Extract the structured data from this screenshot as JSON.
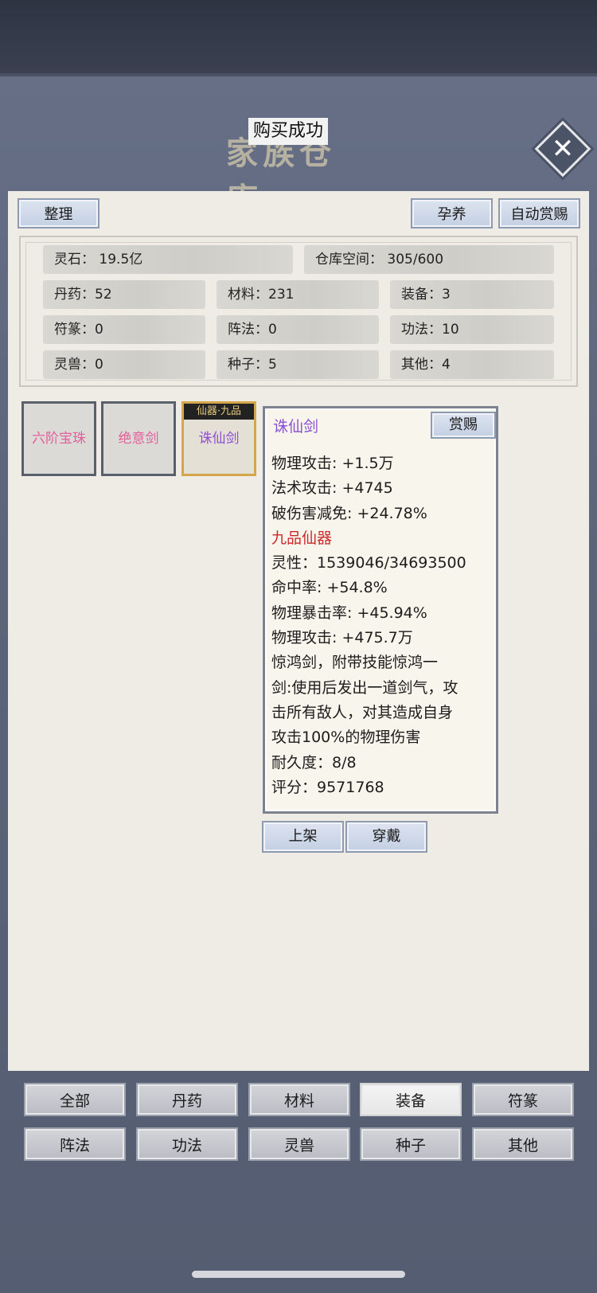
{
  "header": {
    "title": "家族仓库",
    "toast": "购买成功",
    "close_icon": "close-icon"
  },
  "toolbar": {
    "sort_label": "整理",
    "nurture_label": "孕养",
    "auto_reward_label": "自动赏赐"
  },
  "stats": {
    "spirit_stone": "灵石：  19.5亿",
    "capacity": "仓库空间：    305/600",
    "pills": "丹药：52",
    "materials": "材料：231",
    "equipment": "装备：3",
    "talismans": "符篆：0",
    "formations": "阵法：0",
    "techniques": "功法：10",
    "beasts": "灵兽：0",
    "seeds": "种子：5",
    "others": "其他：4"
  },
  "items": [
    {
      "name": "六阶宝珠",
      "color": "#e0609a"
    },
    {
      "name": "绝意剑",
      "color": "#e0609a"
    },
    {
      "name": "诛仙剑",
      "color": "#8d4fd4",
      "tag": "仙器·九品"
    }
  ],
  "detail": {
    "name": "诛仙剑",
    "reward_label": "赏赐",
    "lines": [
      {
        "text": "物理攻击: +1.5万"
      },
      {
        "text": "法术攻击: +4745"
      },
      {
        "text": "破伤害减免: +24.78%"
      },
      {
        "text": "九品仙器",
        "red": true
      },
      {
        "text": "灵性：1539046/34693500"
      },
      {
        "text": "命中率: +54.8%"
      },
      {
        "text": "物理暴击率: +45.94%"
      },
      {
        "text": "物理攻击: +475.7万"
      },
      {
        "text": "惊鸿剑，附带技能惊鸿一"
      },
      {
        "text": "剑:使用后发出一道剑气，攻"
      },
      {
        "text": "击所有敌人，对其造成自身"
      },
      {
        "text": "攻击100%的物理伤害"
      },
      {
        "text": "耐久度：8/8"
      },
      {
        "text": "评分：9571768"
      }
    ],
    "list_label": "上架",
    "equip_label": "穿戴"
  },
  "tabs": [
    "全部",
    "丹药",
    "材料",
    "装备",
    "符篆",
    "阵法",
    "功法",
    "灵兽",
    "种子",
    "其他"
  ],
  "active_tab": "装备"
}
